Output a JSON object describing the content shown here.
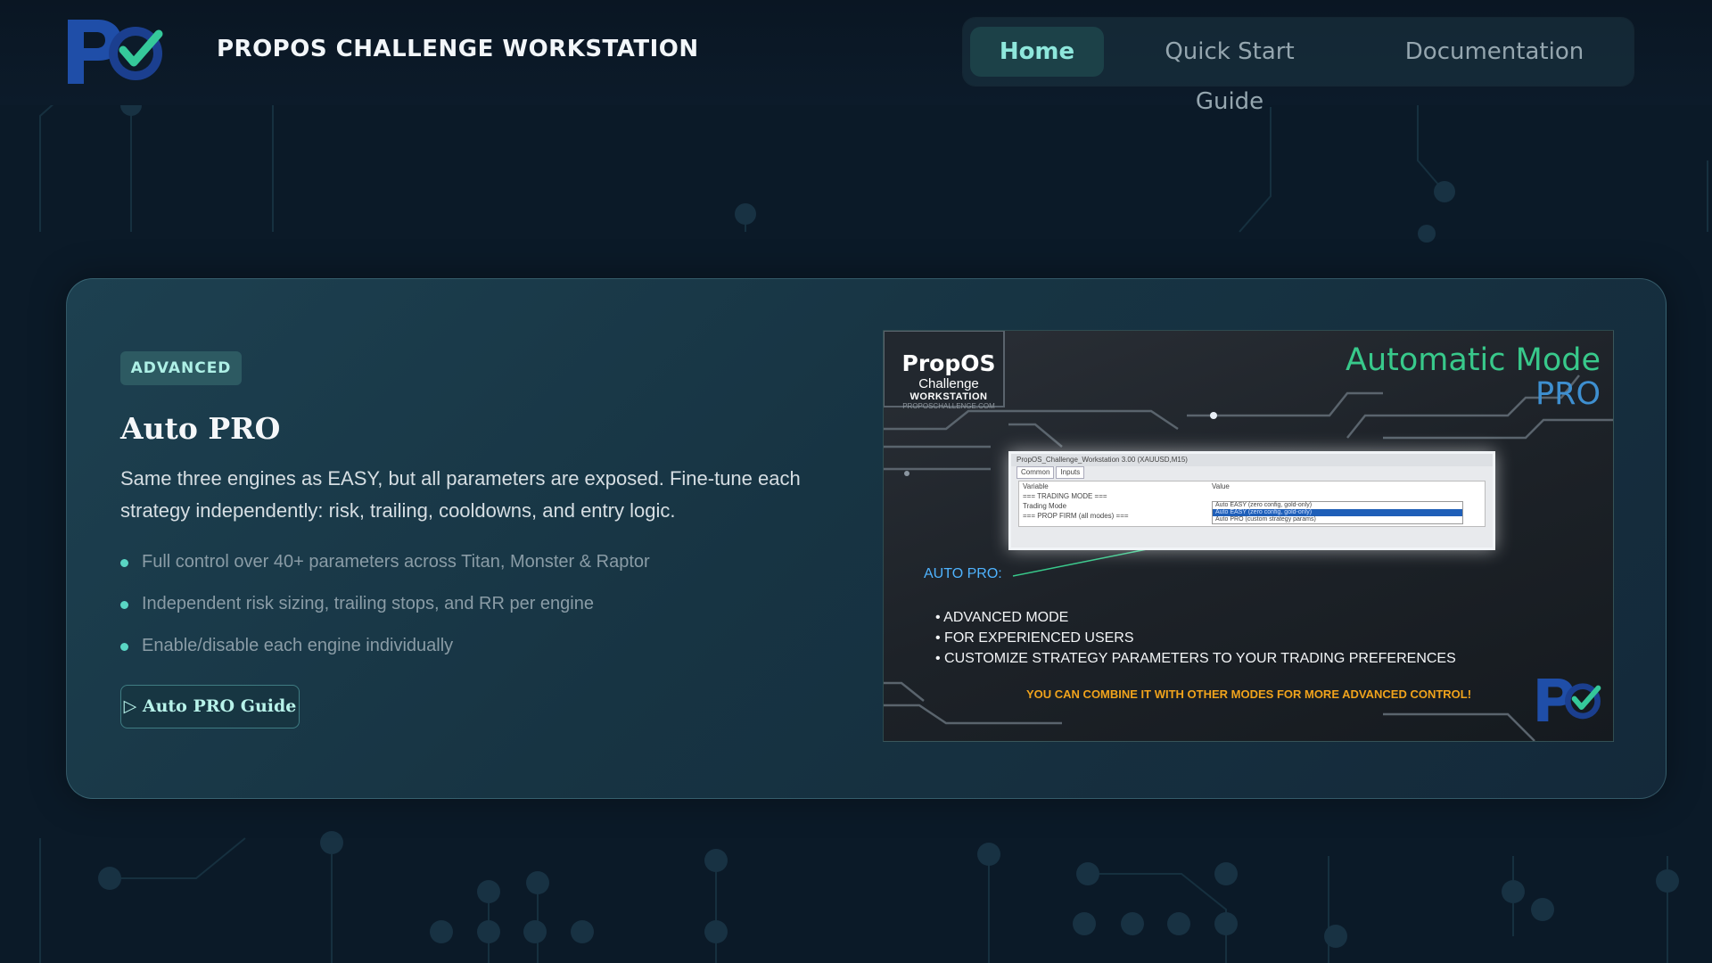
{
  "header": {
    "app_title": "PROPOS CHALLENGE WORKSTATION",
    "nav": [
      {
        "label": "Home",
        "active": true
      },
      {
        "label": "Quick Start Guide",
        "active": false
      },
      {
        "label": "Documentation",
        "active": false
      }
    ]
  },
  "card": {
    "badge": "ADVANCED",
    "title": "Auto PRO",
    "description": "Same three engines as EASY, but all parameters are exposed. Fine-tune each strategy independently: risk, trailing, cooldowns, and entry logic.",
    "features": [
      "Full control over 40+ parameters across Titan, Monster & Raptor",
      "Independent risk sizing, trailing stops, and RR per engine",
      "Enable/disable each engine individually"
    ],
    "guide_button": "▷ Auto PRO Guide"
  },
  "promo": {
    "brand_name": "PropOS",
    "brand_sub1": "Challenge",
    "brand_sub2": "WORKSTATION",
    "brand_url": "PROPOSCHALLENGE.COM",
    "heading_line1": "Automatic Mode",
    "heading_line2": "PRO",
    "window": {
      "title": "PropOS_Challenge_Workstation 3.00 (XAUUSD,M15)",
      "tabs": [
        "Common",
        "Inputs"
      ],
      "columns": [
        "Variable",
        "Value"
      ],
      "rows": [
        "=== TRADING MODE ===",
        "Trading Mode",
        "=== PROP FIRM (all modes) ==="
      ],
      "options": [
        "Auto EASY (zero config, gold-only)",
        "Auto EASY (zero config, gold-only)",
        "Auto PRO (custom strategy params)"
      ]
    },
    "label": "AUTO PRO:",
    "points": [
      "ADVANCED MODE",
      "FOR EXPERIENCED USERS",
      "CUSTOMIZE STRATEGY PARAMETERS TO YOUR TRADING PREFERENCES"
    ],
    "note": "YOU CAN COMBINE IT WITH OTHER MODES FOR MORE ADVANCED CONTROL!"
  },
  "colors": {
    "accent": "#5ad6c4",
    "background": "#0b1a28",
    "promo_green": "#38c98b",
    "promo_blue": "#3e8fd0",
    "promo_orange": "#f0a31c"
  },
  "icons": [
    "propos-logo-icon",
    "checkmark-icon",
    "play-icon"
  ]
}
